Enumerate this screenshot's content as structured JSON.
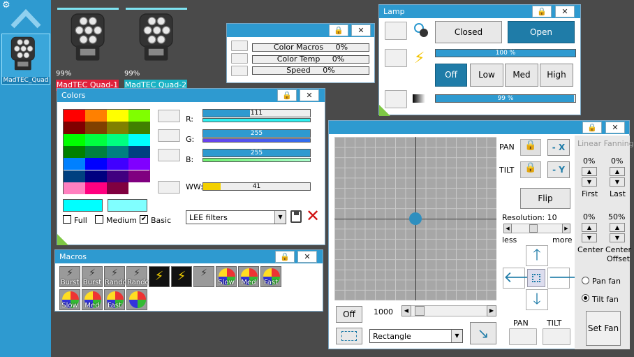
{
  "sidebar": {
    "fixture_label": "MadTEC_Quad"
  },
  "fixtures": [
    {
      "name": "MadTEC Quad-1",
      "percent": "99%",
      "color": "#e0213b"
    },
    {
      "name": "MadTEC Quad-2",
      "percent": "99%",
      "color": "#1ab2c4"
    }
  ],
  "small_panel": {
    "rows": [
      "Color Macros     0%",
      "Color Temp     0%",
      "Speed     0%"
    ]
  },
  "lamp": {
    "title": "Lamp",
    "closed": "Closed",
    "open": "Open",
    "intensity": "100 %",
    "intensity_value": 100,
    "modes": [
      "Off",
      "Low",
      "Med",
      "High"
    ],
    "selected_mode": "Off",
    "dimmer": "99 %",
    "dimmer_value": 99
  },
  "colors": {
    "title": "Colors",
    "swatches": [
      "#ff0000",
      "#ff8000",
      "#ffff00",
      "#80ff00",
      "#800000",
      "#804000",
      "#808000",
      "#408000",
      "#00ff00",
      "#00ff40",
      "#00ff80",
      "#00ffff",
      "#008000",
      "#008040",
      "#008080",
      "#004080",
      "#0080ff",
      "#0000ff",
      "#4000ff",
      "#8000ff",
      "#004080",
      "#000080",
      "#400080",
      "#800080",
      "#ff80c0",
      "#ff0080",
      "#800040",
      "#ffffff"
    ],
    "r_label": "R:",
    "r_value": "111",
    "r_num": 111,
    "g_label": "G:",
    "g_value": "255",
    "g_num": 255,
    "b_label": "B:",
    "b_value": "255",
    "b_num": 255,
    "ww_label": "WW:",
    "ww_value": "41",
    "ww_num": 41,
    "full_label": "Full",
    "medium_label": "Medium",
    "basic_label": "Basic",
    "filter_select": "LEE filters"
  },
  "macros": {
    "title": "Macros",
    "items": [
      "Burst",
      "Burst",
      "Random",
      "Random",
      "",
      "",
      "",
      "Slow",
      "Med",
      "Fast",
      "Slow",
      "Med",
      "Fast",
      ""
    ]
  },
  "pantilt": {
    "pan_label": "PAN",
    "pan_minus": "- X",
    "tilt_label": "TILT",
    "tilt_minus": "- Y",
    "flip": "Flip",
    "resolution": "Resolution: 10",
    "less": "less",
    "more": "more",
    "off": "Off",
    "speed": "1000",
    "shape": "Rectangle",
    "pan_bottom": "PAN",
    "tilt_bottom": "TILT",
    "fanning_title": "Linear Fanning",
    "first_pct": "0%",
    "last_pct": "0%",
    "first": "First",
    "last": "Last",
    "center_pct": "0%",
    "offset_pct": "50%",
    "center": "Center",
    "center_offset": "Center\nOffset",
    "pan_fan": "Pan fan",
    "tilt_fan": "Tilt fan",
    "set_fan": "Set Fan"
  }
}
